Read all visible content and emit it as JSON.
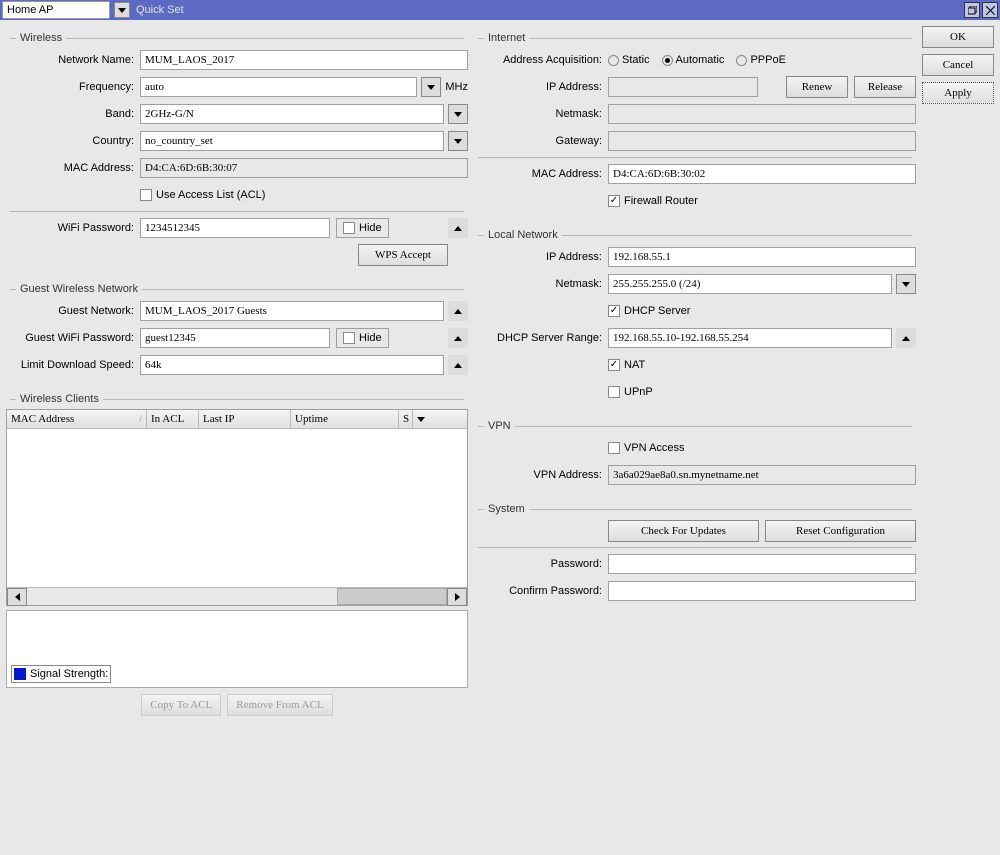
{
  "titlebar": {
    "mode": "Home AP",
    "title": "Quick Set"
  },
  "buttons": {
    "ok": "OK",
    "cancel": "Cancel",
    "apply": "Apply",
    "renew": "Renew",
    "release": "Release",
    "wps": "WPS Accept",
    "check": "Check For Updates",
    "reset": "Reset Configuration",
    "copy": "Copy To ACL",
    "remove": "Remove From ACL"
  },
  "labels": {
    "hide": "Hide",
    "mhz": "MHz"
  },
  "groups": {
    "wireless": "Wireless",
    "internet": "Internet",
    "guest": "Guest Wireless Network",
    "local": "Local Network",
    "clients": "Wireless Clients",
    "vpn": "VPN",
    "system": "System"
  },
  "wireless": {
    "network_name_l": "Network Name:",
    "network_name": "MUM_LAOS_2017",
    "frequency_l": "Frequency:",
    "frequency": "auto",
    "band_l": "Band:",
    "band": "2GHz-G/N",
    "country_l": "Country:",
    "country": "no_country_set",
    "mac_l": "MAC Address:",
    "mac": "D4:CA:6D:6B:30:07",
    "acl": "Use Access List (ACL)",
    "wifi_pw_l": "WiFi Password:",
    "wifi_pw": "1234512345"
  },
  "guest": {
    "net_l": "Guest Network:",
    "net": "MUM_LAOS_2017 Guests",
    "pw_l": "Guest WiFi Password:",
    "pw": "guest12345",
    "limit_l": "Limit Download Speed:",
    "limit": "64k"
  },
  "clients": {
    "c1": "MAC Address",
    "c2": "In ACL",
    "c3": "Last IP",
    "c4": "Uptime",
    "c5": "S",
    "signal": "Signal Strength:"
  },
  "internet": {
    "acq_l": "Address Acquisition:",
    "opt_static": "Static",
    "opt_auto": "Automatic",
    "opt_pppoe": "PPPoE",
    "ip_l": "IP Address:",
    "netmask_l": "Netmask:",
    "gateway_l": "Gateway:",
    "mac_l": "MAC Address:",
    "mac": "D4:CA:6D:6B:30:02",
    "firewall": "Firewall Router"
  },
  "local": {
    "ip_l": "IP Address:",
    "ip": "192.168.55.1",
    "netmask_l": "Netmask:",
    "netmask": "255.255.255.0 (/24)",
    "dhcp": "DHCP Server",
    "range_l": "DHCP Server Range:",
    "range": "192.168.55.10-192.168.55.254",
    "nat": "NAT",
    "upnp": "UPnP"
  },
  "vpn": {
    "access": "VPN Access",
    "addr_l": "VPN Address:",
    "addr": "3a6a029ae8a0.sn.mynetname.net"
  },
  "system": {
    "pw_l": "Password:",
    "cpw_l": "Confirm Password:"
  }
}
